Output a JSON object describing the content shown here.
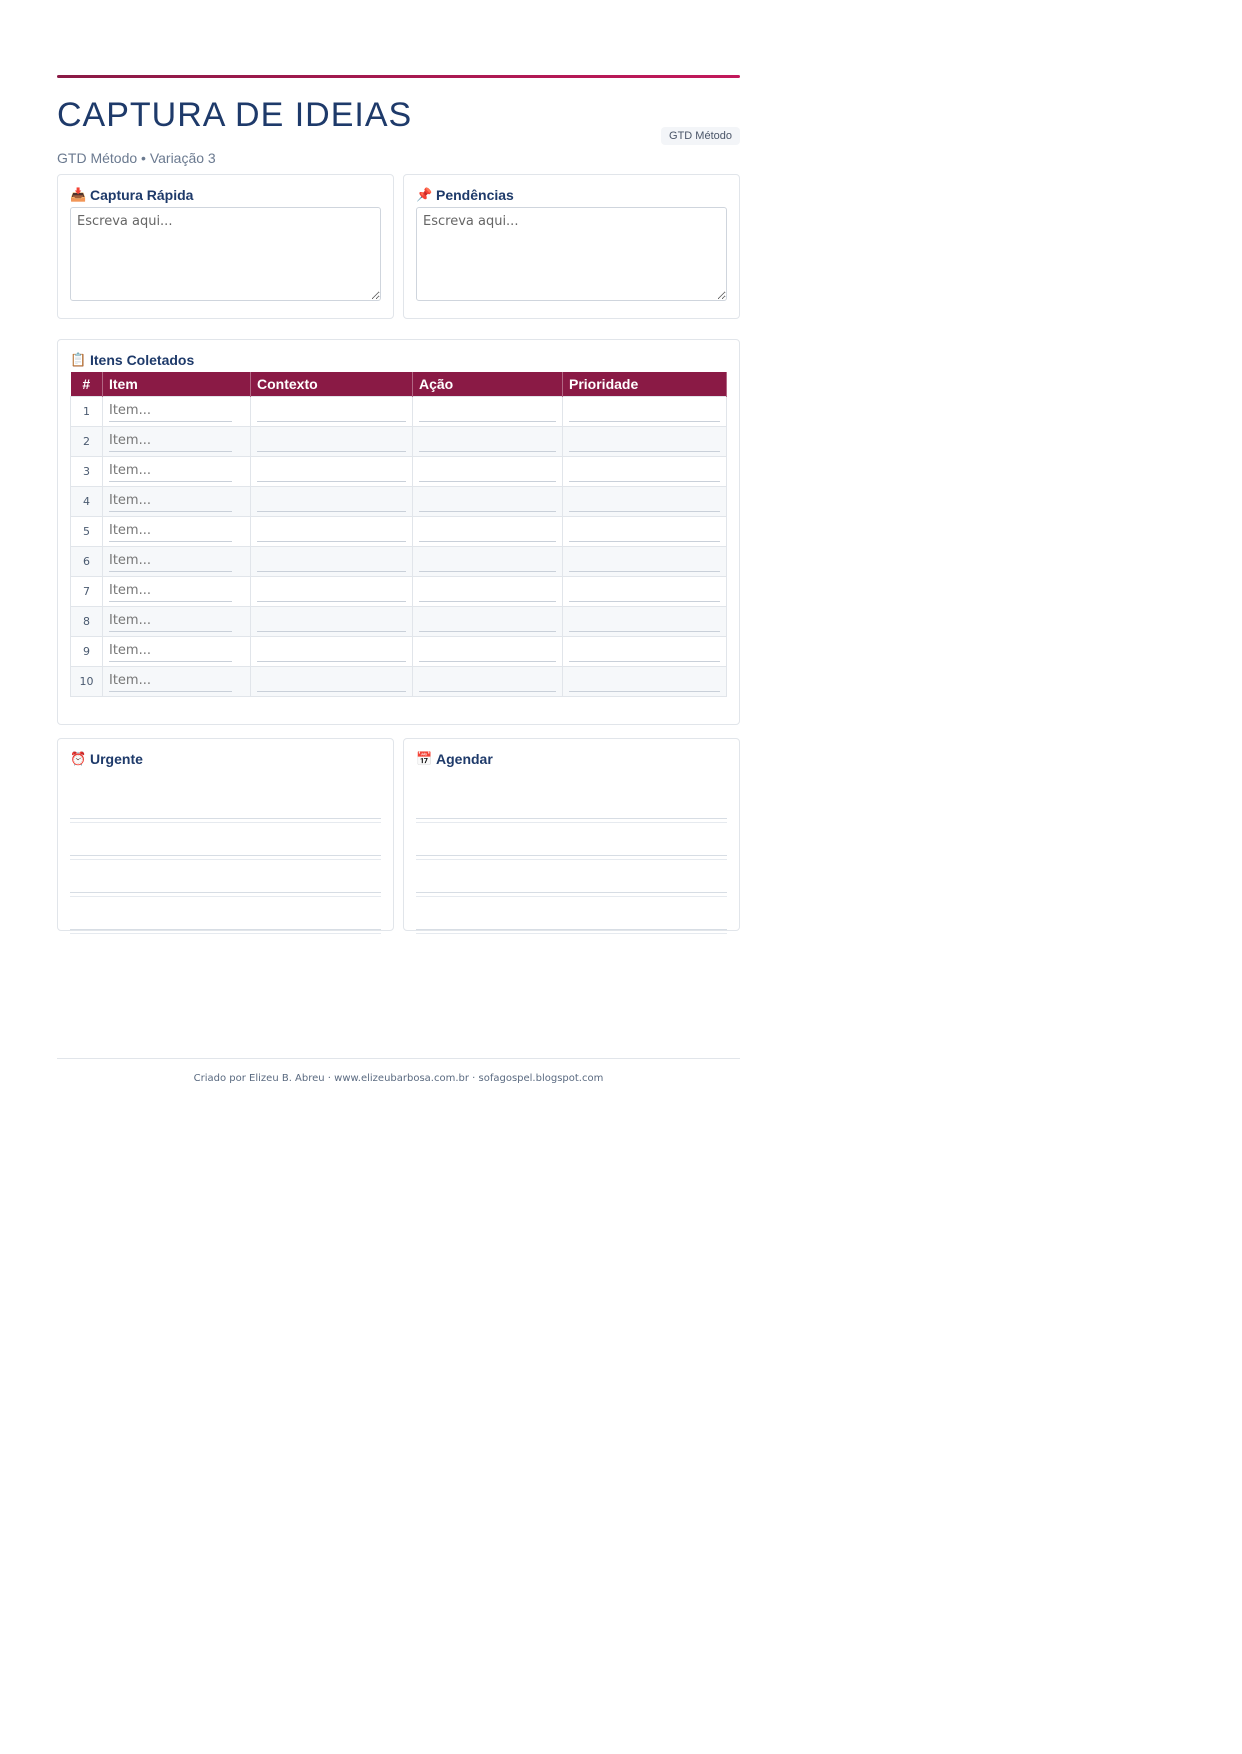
{
  "header": {
    "title": "CAPTURA DE IDEIAS",
    "subtitle": "GTD Método • Variação 3",
    "tag": "GTD Método"
  },
  "capture": {
    "quick": {
      "icon": "📥",
      "icon_name": "inbox-tray-icon",
      "title": "Captura Rápida",
      "placeholder": "Escreva aqui..."
    },
    "pending": {
      "icon": "📌",
      "icon_name": "pushpin-icon",
      "title": "Pendências",
      "placeholder": "Escreva aqui..."
    }
  },
  "items": {
    "icon": "📋",
    "icon_name": "clipboard-icon",
    "title": "Itens Coletados",
    "columns": [
      "#",
      "Item",
      "Contexto",
      "Ação",
      "Prioridade"
    ],
    "rows": [
      {
        "num": "1",
        "item": "Item..."
      },
      {
        "num": "2",
        "item": "Item..."
      },
      {
        "num": "3",
        "item": "Item..."
      },
      {
        "num": "4",
        "item": "Item..."
      },
      {
        "num": "5",
        "item": "Item..."
      },
      {
        "num": "6",
        "item": "Item..."
      },
      {
        "num": "7",
        "item": "Item..."
      },
      {
        "num": "8",
        "item": "Item..."
      },
      {
        "num": "9",
        "item": "Item..."
      },
      {
        "num": "10",
        "item": "Item..."
      }
    ]
  },
  "bottom": {
    "urgent": {
      "icon": "⏰",
      "icon_name": "alarm-clock-icon",
      "title": "Urgente"
    },
    "schedule": {
      "icon": "📅",
      "icon_name": "calendar-icon",
      "title": "Agendar"
    }
  },
  "footer": {
    "text": "Criado por Elizeu B. Abreu · www.elizeubarbosa.com.br · sofagospel.blogspot.com"
  },
  "colors": {
    "accent": "#8a1a45",
    "title": "#1e3a6a"
  }
}
